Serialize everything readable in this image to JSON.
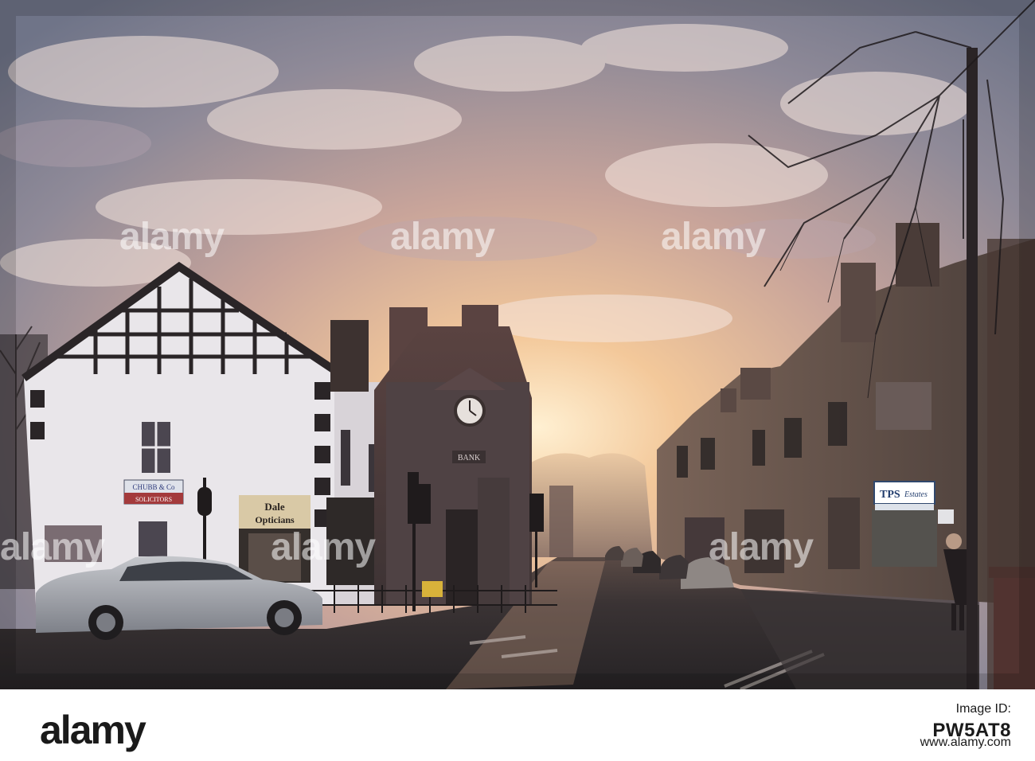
{
  "watermark": {
    "brand": "alamy",
    "logo_text": "alamy",
    "image_id_label": "Image ID:",
    "image_id": "PW5AT8",
    "url": "www.alamy.com"
  },
  "signs": {
    "bank": "BANK",
    "solicitors_name": "CHUBB & Co",
    "solicitors_sub": "SOLICITORS",
    "opticians_line1": "Dale",
    "opticians_line2": "Opticians",
    "estates_brand": "TPS",
    "estates_word": "Estates"
  },
  "colors": {
    "sky_top": "#7d7f8f",
    "sky_glow": "#f3c89a",
    "road": "#2f2b2c",
    "building_dark": "#3a2f2e",
    "white_building": "#e9e6ea"
  }
}
